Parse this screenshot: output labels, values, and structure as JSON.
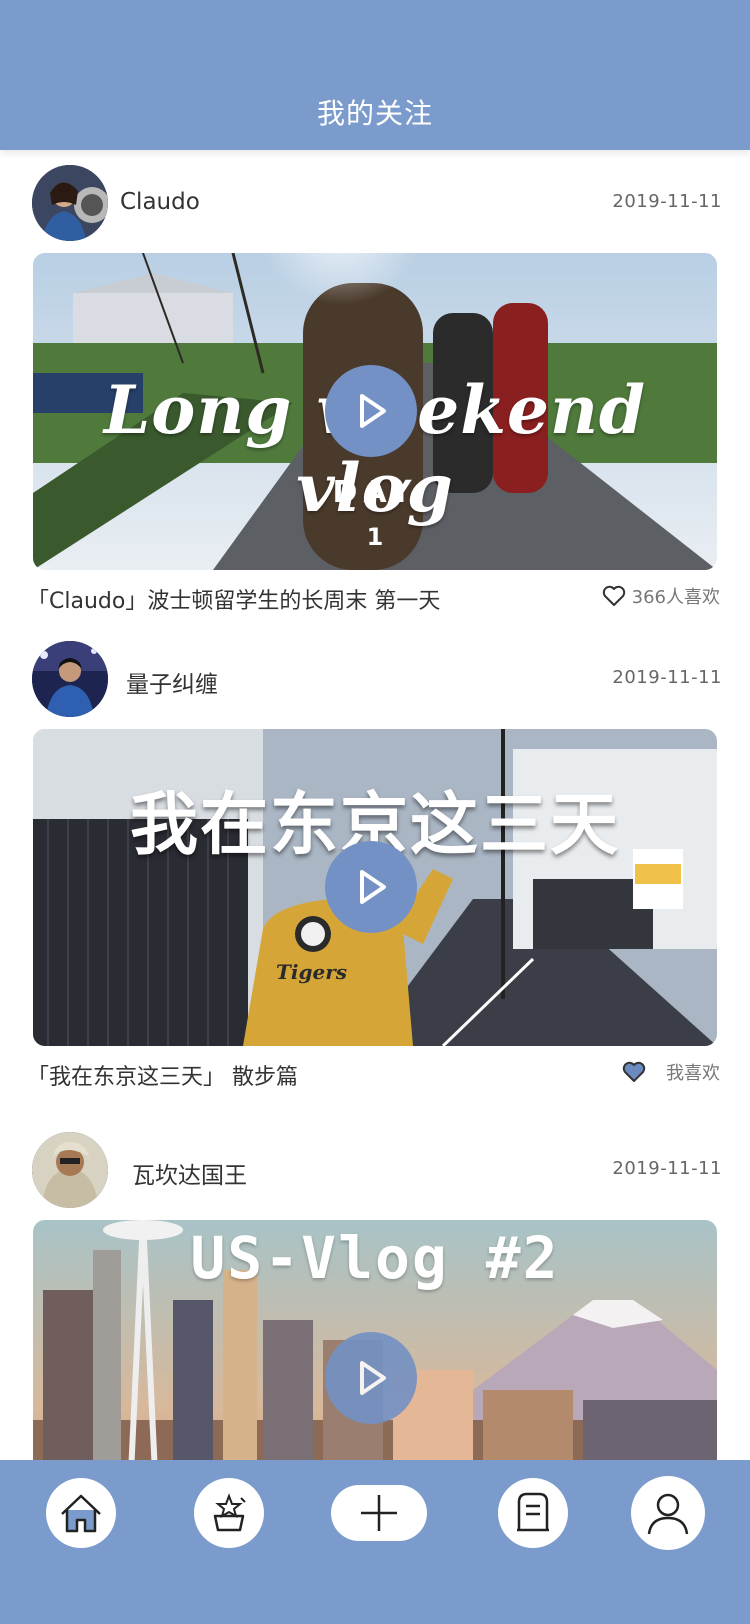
{
  "header": {
    "title": "我的关注"
  },
  "theme": {
    "primary": "#7a9bcb",
    "play_button": "#7391c4",
    "liked_heart": "#6b8bc0"
  },
  "posts": [
    {
      "username": "Claudo",
      "date": "2019-11-11",
      "thumbnail_title": "Long weekend vlog",
      "thumbnail_sub1": "DAY",
      "thumbnail_sub2": "1",
      "caption": "「Claudo」波士顿留学生的长周末 第一天",
      "like_text": "366人喜欢",
      "liked": false,
      "like_icon": "heart-outline-icon"
    },
    {
      "username": "量子纠缠",
      "date": "2019-11-11",
      "thumbnail_title": "我在东京这三天",
      "caption": "「我在东京这三天」 散步篇",
      "like_text": "我喜欢",
      "liked": true,
      "like_icon": "heart-filled-icon"
    },
    {
      "username": "瓦坎达国王",
      "date": "2019-11-11",
      "thumbnail_title": "US-Vlog #2"
    }
  ],
  "bottom_nav": [
    {
      "name": "home",
      "icon": "home-icon"
    },
    {
      "name": "discover",
      "icon": "sparkle-box-icon"
    },
    {
      "name": "add",
      "icon": "plus-icon"
    },
    {
      "name": "notes",
      "icon": "document-icon"
    },
    {
      "name": "profile",
      "icon": "user-icon"
    }
  ]
}
